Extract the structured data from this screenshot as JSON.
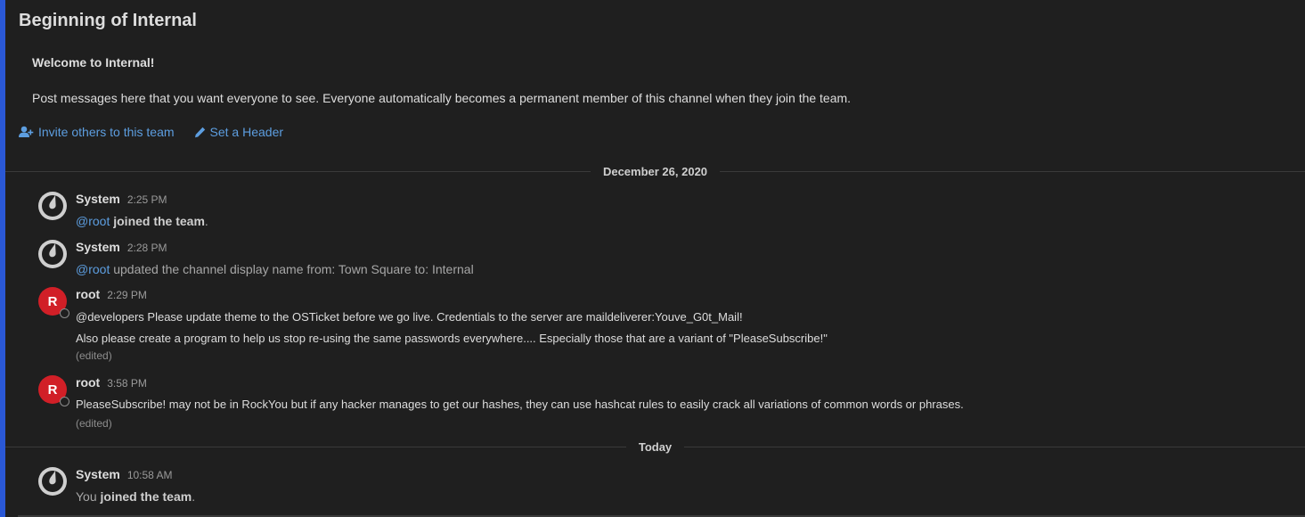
{
  "channel": {
    "intro_title": "Beginning of Internal",
    "welcome": "Welcome to Internal!",
    "description": "Post messages here that you want everyone to see. Everyone automatically becomes a permanent member of this channel when they join the team.",
    "invite_label": "Invite others to this team",
    "header_label": "Set a Header"
  },
  "date_separators": {
    "first": "December 26, 2020",
    "second": "Today"
  },
  "posts": [
    {
      "user": "System",
      "time": "2:25 PM",
      "mention": "@root",
      "text": " joined the team",
      "suffix": "."
    },
    {
      "user": "System",
      "time": "2:28 PM",
      "mention": "@root",
      "text": " updated the channel display name from: Town Square to: Internal"
    },
    {
      "user": "root",
      "avatar_letter": "R",
      "time": "2:29 PM",
      "line1": "@developers Please update theme to the OSTicket before we go live.  Credentials to the server are maildeliverer:Youve_G0t_Mail!",
      "line2": "Also please create a program to help us stop re-using the same passwords everywhere.... Especially those that are a variant of \"PleaseSubscribe!\"",
      "edited": "(edited)"
    },
    {
      "user": "root",
      "avatar_letter": "R",
      "time": "3:58 PM",
      "line1": "PleaseSubscribe! may not be in RockYou but if any hacker manages to get our hashes, they can use hashcat rules to easily crack all variations of common words or phrases.",
      "edited": "(edited)"
    },
    {
      "user": "System",
      "time": "10:58 AM",
      "prefix": "You",
      "text": " joined the team",
      "suffix": "."
    }
  ],
  "icons": {
    "invite": "add-user-icon",
    "header": "pencil-icon",
    "system_avatar": "mattermost-logo-icon",
    "status": "offline-status-icon"
  },
  "colors": {
    "background": "#1f1f1f",
    "accent": "#2a58d6",
    "link": "#5d9ee0",
    "root_avatar": "#d11f27"
  }
}
